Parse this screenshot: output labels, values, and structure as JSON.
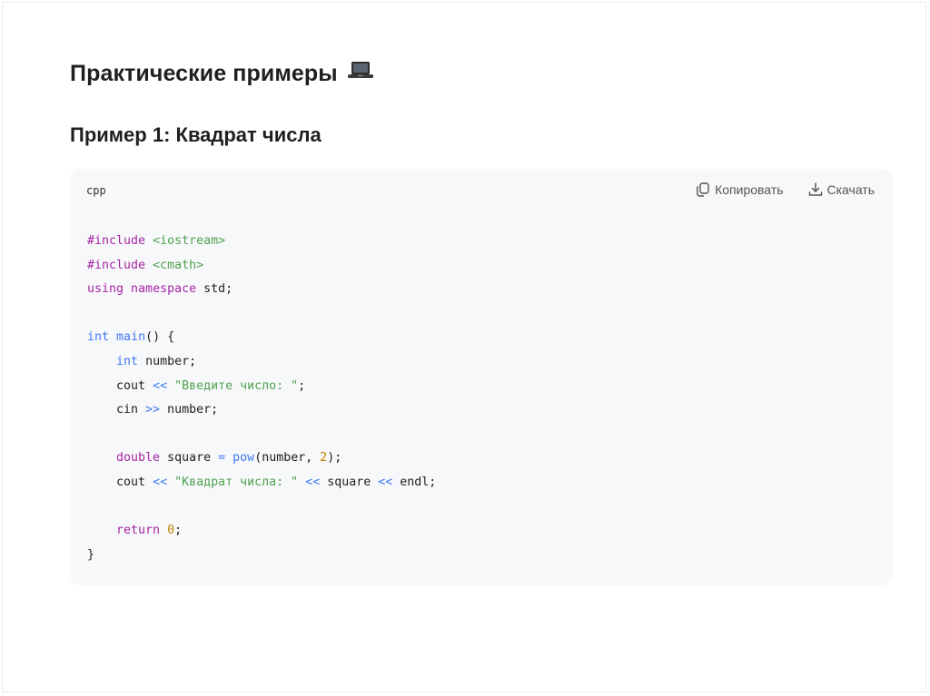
{
  "section": {
    "title": "Практические примеры",
    "emoji": "laptop-icon"
  },
  "example": {
    "title": "Пример 1: Квадрат числа"
  },
  "code": {
    "language": "cpp",
    "copy_label": "Копировать",
    "download_label": "Скачать",
    "lines": [
      [
        {
          "t": "#include",
          "c": "pp"
        },
        {
          "t": " "
        },
        {
          "t": "<iostream>",
          "c": "inc"
        }
      ],
      [
        {
          "t": "#include",
          "c": "pp"
        },
        {
          "t": " "
        },
        {
          "t": "<cmath>",
          "c": "inc"
        }
      ],
      [
        {
          "t": "using",
          "c": "kw"
        },
        {
          "t": " "
        },
        {
          "t": "namespace",
          "c": "kw"
        },
        {
          "t": " std;"
        }
      ],
      [],
      [
        {
          "t": "int",
          "c": "ty"
        },
        {
          "t": " "
        },
        {
          "t": "main",
          "c": "fn"
        },
        {
          "t": "() {"
        }
      ],
      [
        {
          "t": "    "
        },
        {
          "t": "int",
          "c": "ty"
        },
        {
          "t": " number;"
        }
      ],
      [
        {
          "t": "    cout "
        },
        {
          "t": "<<",
          "c": "op"
        },
        {
          "t": " "
        },
        {
          "t": "\"Введите число: \"",
          "c": "str"
        },
        {
          "t": ";"
        }
      ],
      [
        {
          "t": "    cin "
        },
        {
          "t": ">>",
          "c": "op"
        },
        {
          "t": " number;"
        }
      ],
      [],
      [
        {
          "t": "    "
        },
        {
          "t": "double",
          "c": "kw"
        },
        {
          "t": " square "
        },
        {
          "t": "=",
          "c": "op"
        },
        {
          "t": " "
        },
        {
          "t": "pow",
          "c": "fn"
        },
        {
          "t": "(number, "
        },
        {
          "t": "2",
          "c": "num"
        },
        {
          "t": ");"
        }
      ],
      [
        {
          "t": "    cout "
        },
        {
          "t": "<<",
          "c": "op"
        },
        {
          "t": " "
        },
        {
          "t": "\"Квадрат числа: \"",
          "c": "str"
        },
        {
          "t": " "
        },
        {
          "t": "<<",
          "c": "op"
        },
        {
          "t": " square "
        },
        {
          "t": "<<",
          "c": "op"
        },
        {
          "t": " endl;"
        }
      ],
      [],
      [
        {
          "t": "    "
        },
        {
          "t": "return",
          "c": "kw"
        },
        {
          "t": " "
        },
        {
          "t": "0",
          "c": "num"
        },
        {
          "t": ";"
        }
      ],
      [
        {
          "t": "}"
        }
      ]
    ]
  },
  "colors": {
    "code_background": "#f7f8fa",
    "keyword": "#a626a4",
    "type": "#4078f2",
    "string": "#50a14f",
    "number": "#c18401"
  }
}
